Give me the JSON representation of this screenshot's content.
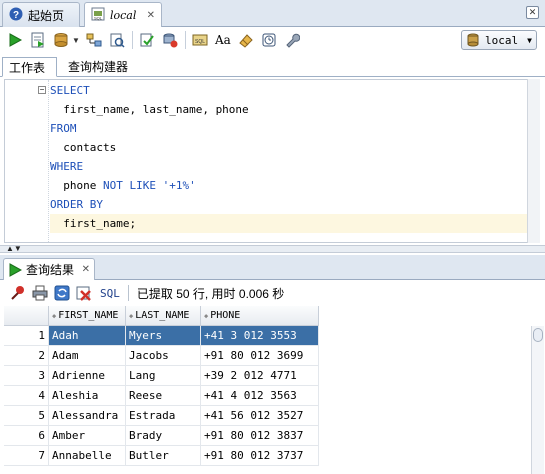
{
  "doc_tabs": [
    {
      "label": "起始页",
      "icon": "help-icon"
    },
    {
      "label": "local",
      "icon": "sql-worksheet-icon"
    }
  ],
  "connection": {
    "selected": "local"
  },
  "worksheet_tabs": [
    {
      "label": "工作表",
      "active": true
    },
    {
      "label": "查询构建器",
      "active": false
    }
  ],
  "editor": {
    "lines": [
      {
        "parts": [
          {
            "t": "kw",
            "v": "SELECT"
          }
        ]
      },
      {
        "parts": [
          {
            "t": "plain",
            "v": "  first_name, last_name, phone"
          }
        ]
      },
      {
        "parts": [
          {
            "t": "kw",
            "v": "FROM"
          }
        ]
      },
      {
        "parts": [
          {
            "t": "plain",
            "v": "  contacts"
          }
        ]
      },
      {
        "parts": [
          {
            "t": "kw",
            "v": "WHERE"
          }
        ]
      },
      {
        "parts": [
          {
            "t": "plain",
            "v": "  phone "
          },
          {
            "t": "kw",
            "v": "NOT LIKE"
          },
          {
            "t": "plain",
            "v": " "
          },
          {
            "t": "str",
            "v": "'+1%'"
          }
        ]
      },
      {
        "parts": [
          {
            "t": "kw",
            "v": "ORDER BY"
          }
        ]
      },
      {
        "parts": [
          {
            "t": "plain",
            "v": "  first_name;"
          }
        ],
        "highlight": true
      }
    ]
  },
  "results": {
    "tab_label": "查询结果",
    "sql_label": "SQL",
    "status": "已提取 50 行, 用时 0.006 秒",
    "columns": [
      "FIRST_NAME",
      "LAST_NAME",
      "PHONE"
    ],
    "rows": [
      {
        "n": "1",
        "first_name": "Adah",
        "last_name": "Myers",
        "phone": "+41 3 012 3553",
        "selected": true
      },
      {
        "n": "2",
        "first_name": "Adam",
        "last_name": "Jacobs",
        "phone": "+91 80 012 3699"
      },
      {
        "n": "3",
        "first_name": "Adrienne",
        "last_name": "Lang",
        "phone": "+39 2 012 4771"
      },
      {
        "n": "4",
        "first_name": "Aleshia",
        "last_name": "Reese",
        "phone": "+41 4 012 3563"
      },
      {
        "n": "5",
        "first_name": "Alessandra",
        "last_name": "Estrada",
        "phone": "+41 56 012 3527"
      },
      {
        "n": "6",
        "first_name": "Amber",
        "last_name": "Brady",
        "phone": "+91 80 012 3837"
      },
      {
        "n": "7",
        "first_name": "Annabelle",
        "last_name": "Butler",
        "phone": "+91 80 012 3737"
      }
    ]
  },
  "colors": {
    "keyword": "#1d4fb8",
    "selection": "#3b6fa6",
    "highlight_line": "#fdf7e0"
  }
}
